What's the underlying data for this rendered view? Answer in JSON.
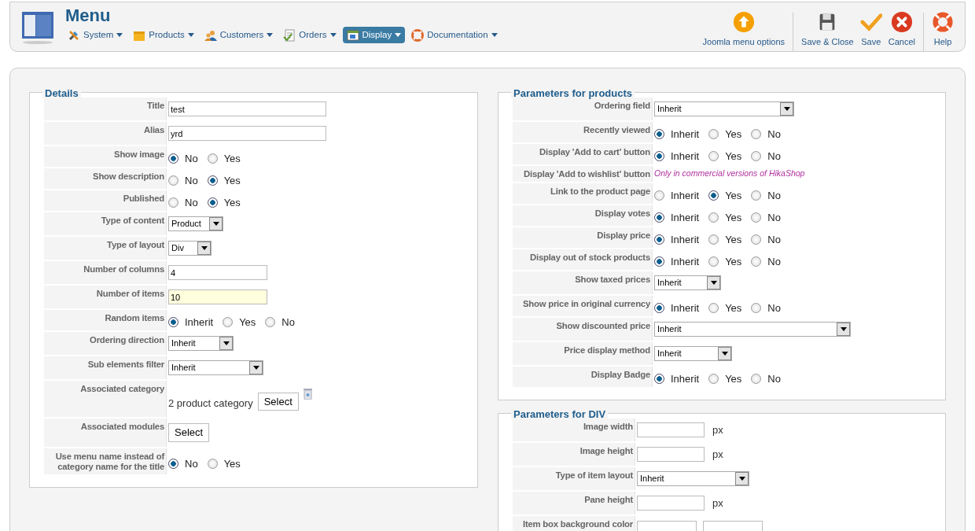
{
  "header": {
    "title": "Menu",
    "menu": [
      {
        "label": "System",
        "selected": false
      },
      {
        "label": "Products",
        "selected": false
      },
      {
        "label": "Customers",
        "selected": false
      },
      {
        "label": "Orders",
        "selected": false
      },
      {
        "label": "Display",
        "selected": true
      },
      {
        "label": "Documentation",
        "selected": false
      }
    ],
    "toolbar": [
      {
        "label": "Joomla menu options"
      },
      {
        "label": "Save & Close"
      },
      {
        "label": "Save"
      },
      {
        "label": "Cancel"
      },
      {
        "label": "Help"
      }
    ]
  },
  "details": {
    "legend": "Details",
    "rows": [
      {
        "kind": "text",
        "label": "Title",
        "value": "test",
        "focused": false
      },
      {
        "kind": "text",
        "label": "Alias",
        "value": "yrd",
        "focused": false
      },
      {
        "kind": "radio",
        "label": "Show image",
        "options": [
          {
            "label": "No",
            "selected": true
          },
          {
            "label": "Yes",
            "selected": false
          }
        ]
      },
      {
        "kind": "radio",
        "label": "Show description",
        "options": [
          {
            "label": "No",
            "selected": false
          },
          {
            "label": "Yes",
            "selected": true
          }
        ]
      },
      {
        "kind": "radio",
        "label": "Published",
        "options": [
          {
            "label": "No",
            "selected": false
          },
          {
            "label": "Yes",
            "selected": true
          }
        ]
      },
      {
        "kind": "select",
        "label": "Type of content",
        "value": "Product"
      },
      {
        "kind": "select",
        "label": "Type of layout",
        "value": "Div"
      },
      {
        "kind": "text",
        "label": "Number of columns",
        "value": "4",
        "focused": false
      },
      {
        "kind": "text",
        "label": "Number of items",
        "value": "10",
        "focused": true
      },
      {
        "kind": "radio",
        "label": "Random items",
        "options": [
          {
            "label": "Inherit",
            "selected": true
          },
          {
            "label": "Yes",
            "selected": false
          },
          {
            "label": "No",
            "selected": false
          }
        ]
      },
      {
        "kind": "select",
        "label": "Ordering direction",
        "value": "Inherit"
      },
      {
        "kind": "select",
        "label": "Sub elements filter",
        "value": "Inherit"
      },
      {
        "kind": "category",
        "label": "Associated category",
        "text": "2 product category",
        "button": "Select"
      },
      {
        "kind": "button",
        "label": "Associated modules",
        "button": "Select"
      },
      {
        "kind": "radio",
        "label": "Use menu name instead of category name for the title",
        "options": [
          {
            "label": "No",
            "selected": true
          },
          {
            "label": "Yes",
            "selected": false
          }
        ]
      }
    ]
  },
  "products": {
    "legend": "Parameters for products",
    "rows": [
      {
        "kind": "select",
        "label": "Ordering field",
        "value": "Inherit"
      },
      {
        "kind": "radio",
        "label": "Recently viewed",
        "options": [
          {
            "label": "Inherit",
            "selected": true
          },
          {
            "label": "Yes",
            "selected": false
          },
          {
            "label": "No",
            "selected": false
          }
        ]
      },
      {
        "kind": "radio",
        "label": "Display 'Add to cart' button",
        "options": [
          {
            "label": "Inherit",
            "selected": true
          },
          {
            "label": "Yes",
            "selected": false
          },
          {
            "label": "No",
            "selected": false
          }
        ]
      },
      {
        "kind": "note",
        "label": "Display 'Add to wishlist' button",
        "note": "Only in commercial versions of HikaShop"
      },
      {
        "kind": "radio",
        "label": "Link to the product page",
        "options": [
          {
            "label": "Inherit",
            "selected": false
          },
          {
            "label": "Yes",
            "selected": true
          },
          {
            "label": "No",
            "selected": false
          }
        ]
      },
      {
        "kind": "radio",
        "label": "Display votes",
        "options": [
          {
            "label": "Inherit",
            "selected": true
          },
          {
            "label": "Yes",
            "selected": false
          },
          {
            "label": "No",
            "selected": false
          }
        ]
      },
      {
        "kind": "radio",
        "label": "Display price",
        "options": [
          {
            "label": "Inherit",
            "selected": true
          },
          {
            "label": "Yes",
            "selected": false
          },
          {
            "label": "No",
            "selected": false
          }
        ]
      },
      {
        "kind": "radio",
        "label": "Display out of stock products",
        "options": [
          {
            "label": "Inherit",
            "selected": true
          },
          {
            "label": "Yes",
            "selected": false
          },
          {
            "label": "No",
            "selected": false
          }
        ]
      },
      {
        "kind": "select",
        "label": "Show taxed prices",
        "value": "Inherit"
      },
      {
        "kind": "radio",
        "label": "Show price in original currency",
        "options": [
          {
            "label": "Inherit",
            "selected": true
          },
          {
            "label": "Yes",
            "selected": false
          },
          {
            "label": "No",
            "selected": false
          }
        ]
      },
      {
        "kind": "select",
        "label": "Show discounted price",
        "value": "Inherit"
      },
      {
        "kind": "select",
        "label": "Price display method",
        "value": "Inherit"
      },
      {
        "kind": "radio",
        "label": "Display Badge",
        "options": [
          {
            "label": "Inherit",
            "selected": true
          },
          {
            "label": "Yes",
            "selected": false
          },
          {
            "label": "No",
            "selected": false
          }
        ]
      }
    ]
  },
  "div": {
    "legend": "Parameters for DIV",
    "rows": [
      {
        "kind": "px",
        "label": "Image width",
        "unit": "px"
      },
      {
        "kind": "px",
        "label": "Image height",
        "unit": "px"
      },
      {
        "kind": "select",
        "label": "Type of item layout",
        "value": "Inherit"
      },
      {
        "kind": "px",
        "label": "Pane height",
        "unit": "px"
      },
      {
        "kind": "color",
        "label": "Item box background color"
      }
    ]
  }
}
